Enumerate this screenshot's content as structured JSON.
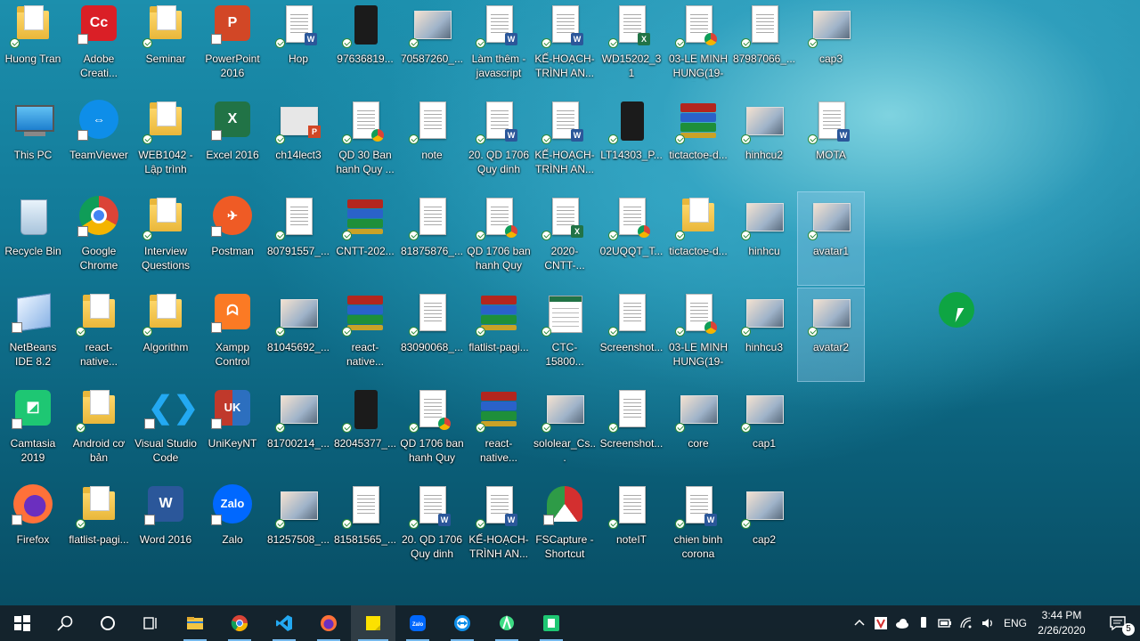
{
  "desktop": {
    "icons": [
      {
        "label": "Huong Tran",
        "type": "folder"
      },
      {
        "label": "Adobe Creati...",
        "type": "adobe"
      },
      {
        "label": "Seminar",
        "type": "folder"
      },
      {
        "label": "PowerPoint 2016",
        "type": "powerpoint"
      },
      {
        "label": "Hop",
        "type": "word-doc"
      },
      {
        "label": "97636819...",
        "type": "dark-image"
      },
      {
        "label": "70587260_...",
        "type": "image"
      },
      {
        "label": "Làm thêm - javascript",
        "type": "word-doc"
      },
      {
        "label": "KẾ-HOẠCH-TRÌNH AN...",
        "type": "word-doc"
      },
      {
        "label": "WD15202_31",
        "type": "excel-doc"
      },
      {
        "label": "03-LE MINH HUNG(19-2...",
        "type": "chrome-doc"
      },
      {
        "label": "87987066_...",
        "type": "doc"
      },
      {
        "label": "cap3",
        "type": "image"
      },
      {
        "label": "This PC",
        "type": "pc"
      },
      {
        "label": "TeamViewer",
        "type": "teamviewer"
      },
      {
        "label": "WEB1042 - Lập trình cơ...",
        "type": "folder"
      },
      {
        "label": "Excel 2016",
        "type": "excel"
      },
      {
        "label": "ch14lect3",
        "type": "ppt-doc"
      },
      {
        "label": "QD 30 Ban hanh Quy ...",
        "type": "chrome-doc"
      },
      {
        "label": "note",
        "type": "doc"
      },
      {
        "label": "20. QD 1706 Quy dinh ch...",
        "type": "word-doc"
      },
      {
        "label": "KẾ-HOẠCH-TRÌNH AN...",
        "type": "word-doc"
      },
      {
        "label": "LT14303_P...",
        "type": "dark-image"
      },
      {
        "label": "tictactoe-d...",
        "type": "rar"
      },
      {
        "label": "hinhcu2",
        "type": "image"
      },
      {
        "label": "MOTA",
        "type": "word-doc"
      },
      {
        "label": "Recycle Bin",
        "type": "bin"
      },
      {
        "label": "Google Chrome",
        "type": "chrome"
      },
      {
        "label": "Interview Questions",
        "type": "folder"
      },
      {
        "label": "Postman",
        "type": "postman"
      },
      {
        "label": "80791557_...",
        "type": "doc"
      },
      {
        "label": "CNTT-202...",
        "type": "rar"
      },
      {
        "label": "81875876_...",
        "type": "doc"
      },
      {
        "label": "QD 1706 ban hanh Quy d...",
        "type": "chrome-doc"
      },
      {
        "label": "2020-CNTT-...",
        "type": "excel-doc"
      },
      {
        "label": "02UQQT_T...",
        "type": "chrome-doc"
      },
      {
        "label": "tictactoe-d...",
        "type": "folder"
      },
      {
        "label": "hinhcu",
        "type": "image"
      },
      {
        "label": "avatar1",
        "type": "image"
      },
      {
        "label": "NetBeans IDE 8.2",
        "type": "netbeans"
      },
      {
        "label": "react-native...",
        "type": "folder"
      },
      {
        "label": "Algorithm",
        "type": "folder"
      },
      {
        "label": "Xampp Control",
        "type": "xampp"
      },
      {
        "label": "81045692_...",
        "type": "image"
      },
      {
        "label": "react-native...",
        "type": "rar"
      },
      {
        "label": "83090068_...",
        "type": "doc"
      },
      {
        "label": "flatlist-pagi...",
        "type": "rar"
      },
      {
        "label": "CTC-15800...",
        "type": "sheet"
      },
      {
        "label": "Screenshot...",
        "type": "doc"
      },
      {
        "label": "03-LE MINH HUNG(19-2...",
        "type": "chrome-doc"
      },
      {
        "label": "hinhcu3",
        "type": "image"
      },
      {
        "label": "avatar2",
        "type": "image"
      },
      {
        "label": "Camtasia 2019",
        "type": "camtasia"
      },
      {
        "label": "Android cơ bản",
        "type": "folder"
      },
      {
        "label": "Visual Studio Code",
        "type": "vscode"
      },
      {
        "label": "UniKeyNT",
        "type": "unikey"
      },
      {
        "label": "81700214_...",
        "type": "image"
      },
      {
        "label": "82045377_...",
        "type": "dark-image"
      },
      {
        "label": "QD 1706 ban hanh Quy d...",
        "type": "chrome-doc"
      },
      {
        "label": "react-native...",
        "type": "rar"
      },
      {
        "label": "sololear_Cs...",
        "type": "image"
      },
      {
        "label": "Screenshot...",
        "type": "doc"
      },
      {
        "label": "core",
        "type": "image"
      },
      {
        "label": "cap1",
        "type": "image"
      },
      {
        "label": "Firefox",
        "type": "firefox"
      },
      {
        "label": "flatlist-pagi...",
        "type": "folder"
      },
      {
        "label": "Word 2016",
        "type": "word"
      },
      {
        "label": "Zalo",
        "type": "zalo"
      },
      {
        "label": "81257508_...",
        "type": "image"
      },
      {
        "label": "81581565_...",
        "type": "doc"
      },
      {
        "label": "20. QD 1706 Quy dinh ch...",
        "type": "word-doc"
      },
      {
        "label": "KẾ-HOẠCH-TRÌNH AN...",
        "type": "word-doc"
      },
      {
        "label": "FSCapture - Shortcut",
        "type": "fscapture"
      },
      {
        "label": "noteIT",
        "type": "doc"
      },
      {
        "label": "chien binh corona",
        "type": "word-doc"
      },
      {
        "label": "cap2",
        "type": "image"
      }
    ]
  },
  "taskbar": {
    "items": [
      {
        "name": "start-button",
        "icon": "windows-icon"
      },
      {
        "name": "search-button",
        "icon": "search-icon"
      },
      {
        "name": "cortana-button",
        "icon": "circle-icon"
      },
      {
        "name": "task-view-button",
        "icon": "task-view-icon"
      },
      {
        "name": "file-explorer",
        "icon": "folder-icon"
      },
      {
        "name": "google-chrome",
        "icon": "chrome-icon"
      },
      {
        "name": "visual-studio-code",
        "icon": "vscode-icon"
      },
      {
        "name": "firefox",
        "icon": "firefox-icon"
      },
      {
        "name": "sticky-notes",
        "icon": "sticky-notes-icon"
      },
      {
        "name": "zalo",
        "icon": "zalo-icon"
      },
      {
        "name": "teamviewer",
        "icon": "teamviewer-icon"
      },
      {
        "name": "android-studio",
        "icon": "android-studio-icon"
      },
      {
        "name": "camtasia",
        "icon": "camtasia-icon"
      }
    ],
    "tray": {
      "language": "ENG",
      "time": "3:44 PM",
      "date": "2/26/2020",
      "notifications": "5"
    }
  },
  "colors": {
    "word": "#2b579a",
    "excel": "#217346",
    "powerpoint": "#d24726",
    "taskbar": "#162028",
    "accent": "#76b9ed"
  }
}
